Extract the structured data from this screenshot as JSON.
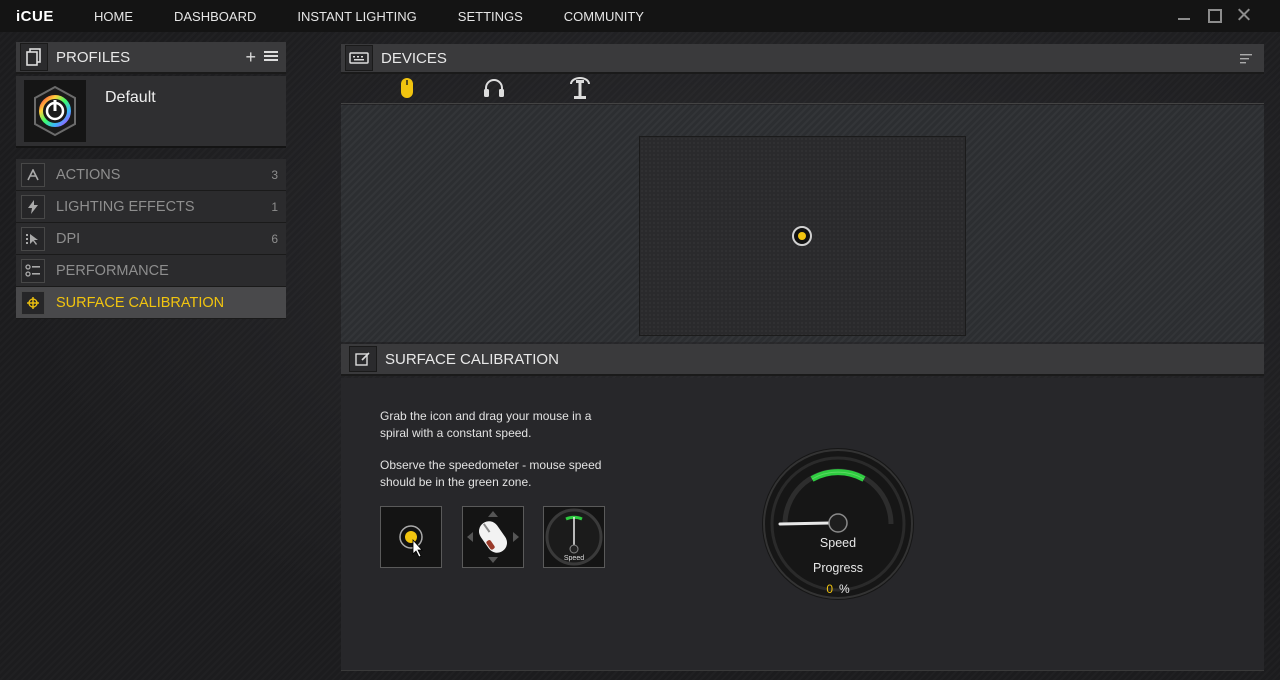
{
  "app": {
    "logo": "iCUE"
  },
  "nav": [
    "HOME",
    "DASHBOARD",
    "INSTANT LIGHTING",
    "SETTINGS",
    "COMMUNITY"
  ],
  "profiles": {
    "title": "PROFILES",
    "add_label": "+",
    "current": "Default"
  },
  "menu": [
    {
      "label": "ACTIONS",
      "count": "3",
      "icon": "letter-a-icon"
    },
    {
      "label": "LIGHTING EFFECTS",
      "count": "1",
      "icon": "lightning-icon"
    },
    {
      "label": "DPI",
      "count": "6",
      "icon": "dpi-cursor-icon"
    },
    {
      "label": "PERFORMANCE",
      "count": "",
      "icon": "sliders-icon"
    },
    {
      "label": "SURFACE CALIBRATION",
      "count": "",
      "icon": "crosshair-icon",
      "active": true
    }
  ],
  "devices": {
    "title": "DEVICES",
    "tabs": [
      "mouse-icon",
      "headset-icon",
      "headset-stand-icon"
    ],
    "selected_tab": "mouse-icon"
  },
  "calibration": {
    "title": "SURFACE CALIBRATION",
    "instruction_1": "Grab the icon and drag your mouse in a spiral with a constant speed.",
    "instruction_2": "Observe the speedometer - mouse speed should be in the green zone.",
    "thumb_speed_label": "Speed",
    "gauge": {
      "speed_label": "Speed",
      "progress_label": "Progress",
      "progress_value": "0",
      "progress_unit": "%"
    }
  },
  "colors": {
    "accent": "#f1c40f",
    "green_zone": "#2ecc40",
    "active_item_bg": "#49494b"
  }
}
